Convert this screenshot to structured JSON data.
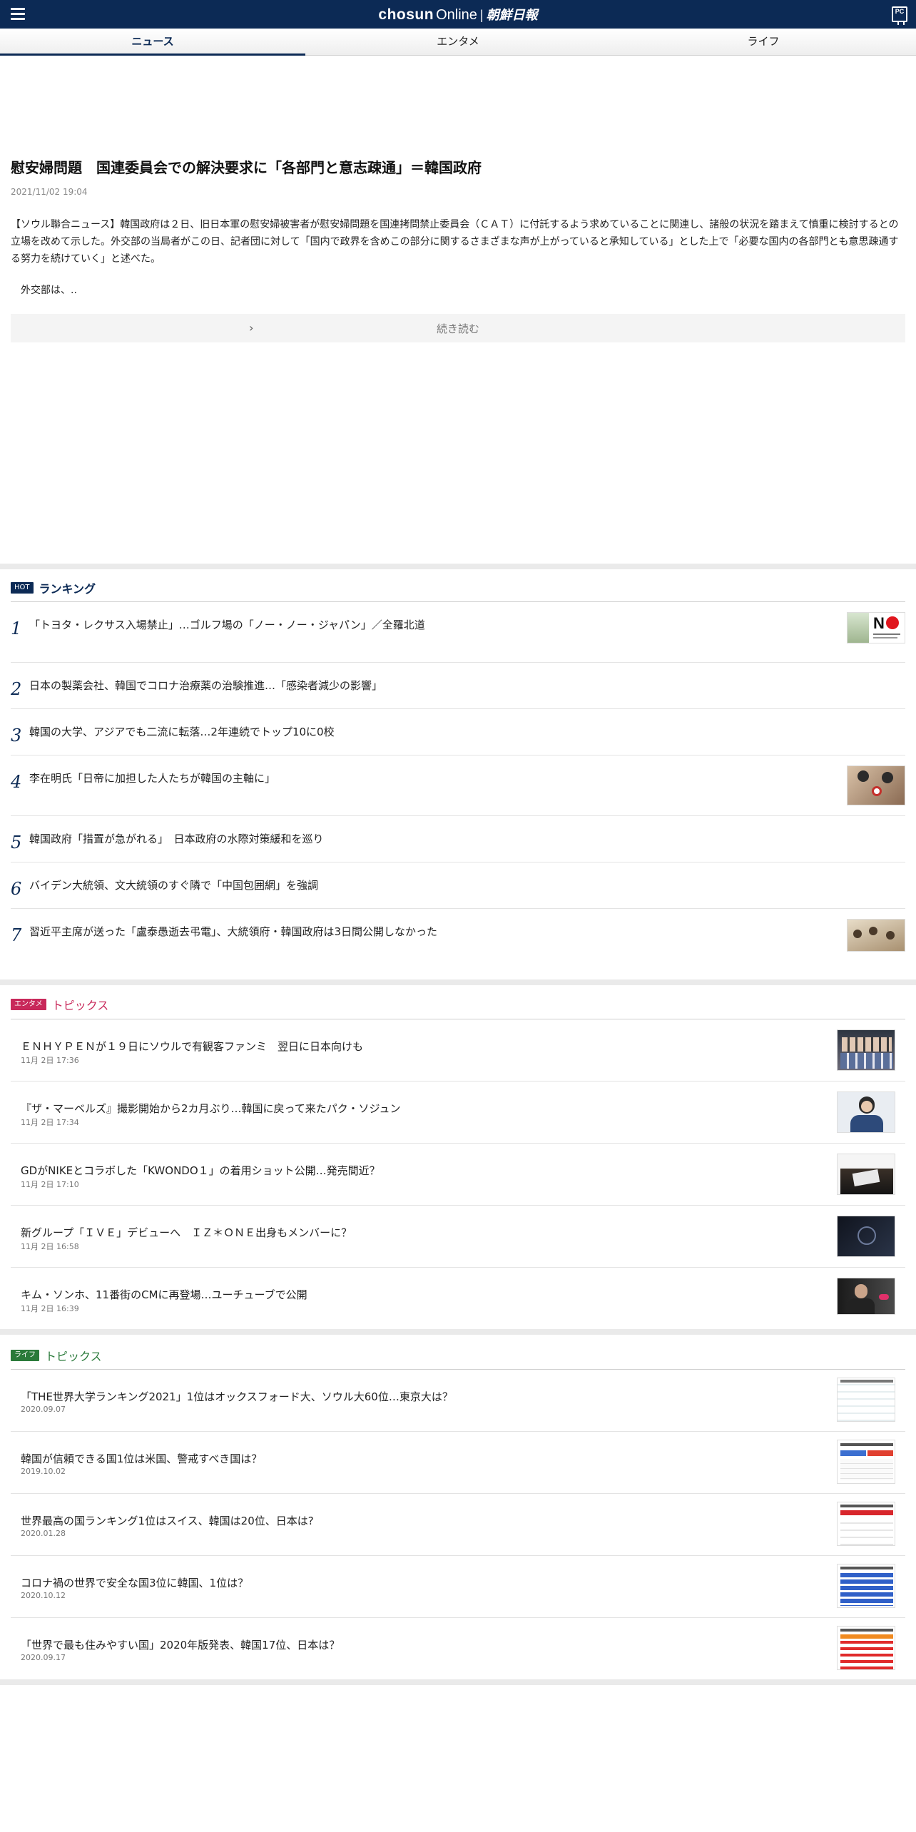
{
  "header": {
    "logo_brand": "chosun",
    "logo_online": "Online",
    "logo_sep": "|",
    "logo_kanji": "朝鮮日報",
    "pc_label": "PC"
  },
  "tabs": [
    {
      "label": "ニュース",
      "active": true
    },
    {
      "label": "エンタメ",
      "active": false
    },
    {
      "label": "ライフ",
      "active": false
    }
  ],
  "article": {
    "title": "慰安婦問題　国連委員会での解決要求に「各部門と意志疎通」＝韓国政府",
    "date": "2021/11/02 19:04",
    "body": "【ソウル聯合ニュース】韓国政府は２日、旧日本軍の慰安婦被害者が慰安婦問題を国連拷問禁止委員会（ＣＡＴ）に付託するよう求めていることに関連し、諸般の状況を踏まえて慎重に検討するとの立場を改めて示した。外交部の当局者がこの日、記者団に対して「国内で政界を含めこの部分に関するさまざまな声が上がっていると承知している」とした上で「必要な国内の各部門とも意思疎通する努力を続けていく」と述べた。",
    "more_text": "外交部は、..",
    "readmore_label": "続き読む"
  },
  "ranking": {
    "badge": "HOT",
    "title": "ランキング",
    "items": [
      {
        "num": "1",
        "title": "「トヨタ・レクサス入場禁止」…ゴルフ場の「ノー・ノー・ジャパン」／全羅北道",
        "thumb": "no-japan-image"
      },
      {
        "num": "2",
        "title": "日本の製薬会社、韓国でコロナ治療薬の治験推進…「感染者減少の影響」",
        "thumb": ""
      },
      {
        "num": "3",
        "title": "韓国の大学、アジアでも二流に転落…2年連続でトップ10に0校",
        "thumb": ""
      },
      {
        "num": "4",
        "title": "李在明氏「日帝に加担した人たちが韓国の主軸に」",
        "thumb": "politician-photo"
      },
      {
        "num": "5",
        "title": "韓国政府「措置が急がれる」　日本政府の水際対策緩和を巡り",
        "thumb": ""
      },
      {
        "num": "6",
        "title": "バイデン大統領、文大統領のすぐ隣で「中国包囲網」を強調",
        "thumb": ""
      },
      {
        "num": "7",
        "title": "習近平主席が送った「盧泰愚逝去弔電」、大統領府・韓国政府は3日間公開しなかった",
        "thumb": "meeting-photo"
      }
    ]
  },
  "entame": {
    "badge": "エンタメ",
    "title": "トピックス",
    "color": "#c8285a",
    "items": [
      {
        "title": "ＥＮＨＹＰＥＮが１９日にソウルで有観客ファンミ　翌日に日本向けも",
        "date": "11月 2日 17:36"
      },
      {
        "title": "『ザ・マーベルズ』撮影開始から2カ月ぶり…韓国に戻って来たパク・ソジュン",
        "date": "11月 2日 17:34"
      },
      {
        "title": "GDがNIKEとコラボした「KWONDO１」の着用ショット公開…発売間近？",
        "date": "11月 2日 17:10"
      },
      {
        "title": "新グループ「ＩＶＥ」デビューへ　ＩＺ＊ＯＮＥ出身もメンバーに？",
        "date": "11月 2日 16:58"
      },
      {
        "title": "キム・ソンホ、11番街のCMに再登場…ユーチューブで公開",
        "date": "11月 2日 16:39"
      }
    ]
  },
  "life": {
    "badge": "ライフ",
    "title": "トピックス",
    "color": "#2a7a3a",
    "items": [
      {
        "title": "「THE世界大学ランキング2021」1位はオックスフォード大、ソウル大60位…東京大は？",
        "date": "2020.09.07"
      },
      {
        "title": "韓国が信頼できる国1位は米国、警戒すべき国は？",
        "date": "2019.10.02"
      },
      {
        "title": "世界最高の国ランキング1位はスイス、韓国は20位、日本は?",
        "date": "2020.01.28"
      },
      {
        "title": "コロナ禍の世界で安全な国3位に韓国、1位は？",
        "date": "2020.10.12"
      },
      {
        "title": "「世界で最も住みやすい国」2020年版発表、韓国17位、日本は？",
        "date": "2020.09.17"
      }
    ]
  },
  "colors": {
    "navy": "#0c2a55",
    "entame": "#c8285a",
    "life": "#2a7a3a"
  }
}
